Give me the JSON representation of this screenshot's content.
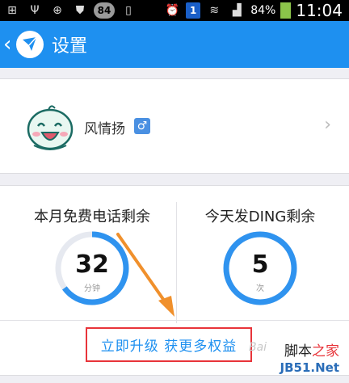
{
  "status_bar": {
    "badge": "84",
    "notification": "1",
    "battery_percent": "84%",
    "time": "11:04",
    "icons": [
      "add-icon",
      "usb-icon",
      "gps-icon",
      "shield-icon",
      "badge-icon",
      "phone-icon",
      "alarm-icon",
      "notification-icon",
      "wifi-icon",
      "signal-icon",
      "battery-icon"
    ]
  },
  "header": {
    "back_icon": "chevron-left-icon",
    "title": "设置",
    "accent": "#1e90f0"
  },
  "profile": {
    "name": "风情扬",
    "gender_symbol": "♂",
    "gender_icon": "male-icon",
    "chevron": "›"
  },
  "quota": {
    "calls_label": "本月免费电话剩余",
    "calls_value": "32",
    "calls_unit": "分钟",
    "calls_ring_fraction": 0.65,
    "ding_label": "今天发DING剩余",
    "ding_value": "5",
    "ding_unit": "次",
    "ding_ring_fraction": 1.0,
    "ring_color": "#2f93ef",
    "upgrade_link": "立即升级 获更多权益"
  },
  "annotation": {
    "highlight_color": "#e8343a",
    "arrow_color": "#f0902c"
  },
  "watermark": {
    "top_a": "脚本",
    "top_b": "之家",
    "bottom": "JB51.Net",
    "baidu": "Bai"
  }
}
